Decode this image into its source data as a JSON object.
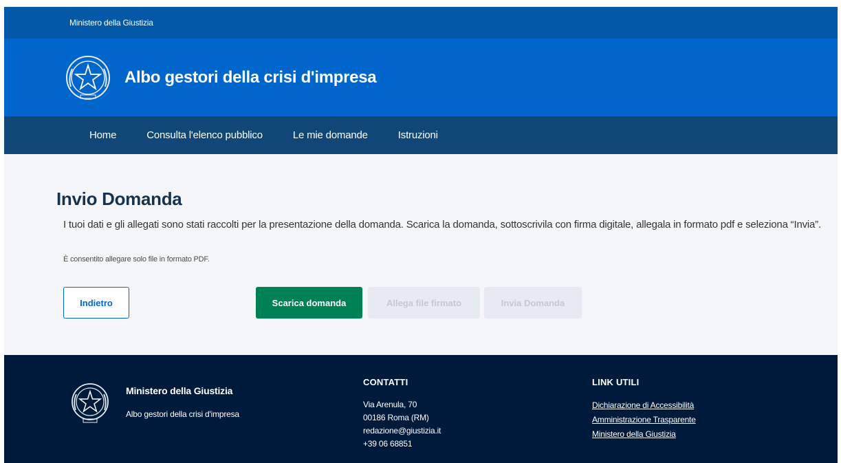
{
  "slim_header": {
    "label": "Ministero della Giustizia"
  },
  "header": {
    "title": "Albo gestori della crisi d'impresa"
  },
  "nav": {
    "items": [
      "Home",
      "Consulta l'elenco pubblico",
      "Le mie domande",
      "Istruzioni"
    ]
  },
  "main": {
    "title": "Invio Domanda",
    "intro": "I tuoi dati e gli allegati sono stati raccolti per la presentazione della domanda. Scarica la domanda, sottoscrivila con firma digitale, allegala in formato pdf e seleziona “Invia”.",
    "note": "È consentito allegare solo file in formato PDF.",
    "buttons": {
      "back": "Indietro",
      "download": "Scarica domanda",
      "attach": "Allega file firmato",
      "send": "Invia Domanda"
    }
  },
  "footer": {
    "org": "Ministero della Giustizia",
    "sub": "Albo gestori della crisi d'impresa",
    "contacts": {
      "title": "CONTATTI",
      "lines": [
        "Via Arenula, 70",
        "00186 Roma (RM)",
        "redazione@giustizia.it",
        "+39 06 68851"
      ]
    },
    "links": {
      "title": "LINK UTILI",
      "items": [
        "Dichiarazione di Accessibilità",
        "Amministrazione Trasparente",
        "Ministero della Giustizia"
      ]
    }
  },
  "colors": {
    "slim_header": "#0359a8",
    "header": "#0066cc",
    "navbar": "#114777",
    "primary_green": "#008055",
    "footer": "#001a3c"
  }
}
